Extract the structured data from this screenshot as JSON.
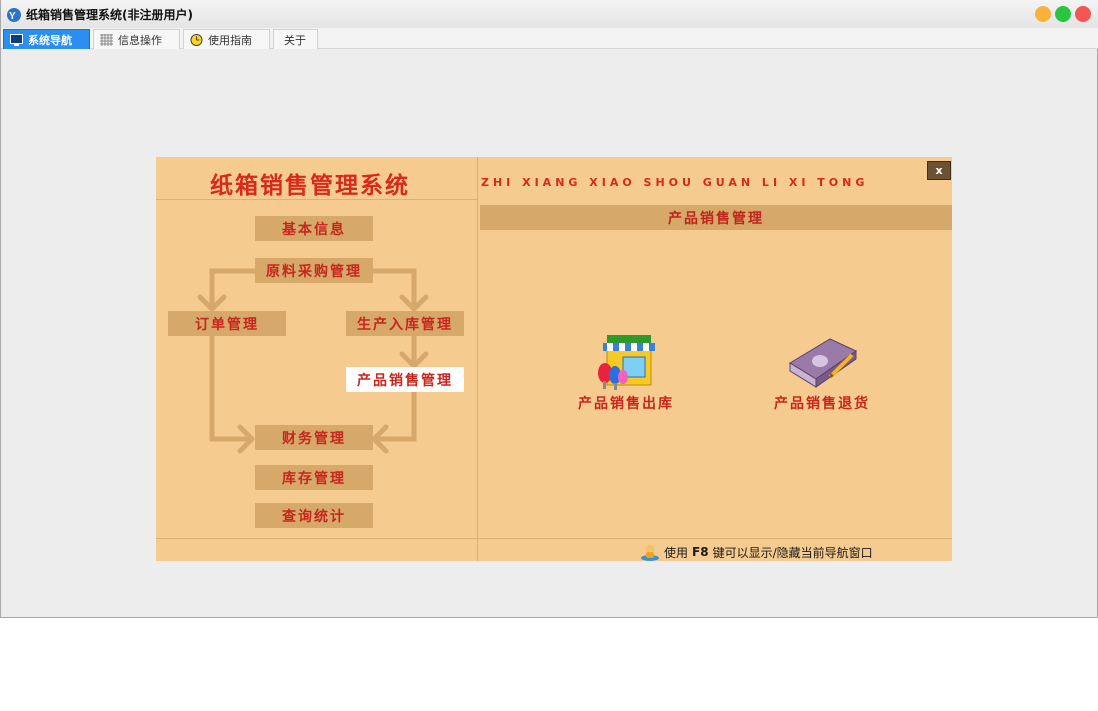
{
  "window": {
    "title": "纸箱销售管理系统(非注册用户)",
    "icon": "app-logo-icon"
  },
  "tabs": [
    {
      "label": "系统导航",
      "icon": "monitor-icon",
      "active": true
    },
    {
      "label": "信息操作",
      "icon": "grid-icon",
      "active": false
    },
    {
      "label": "使用指南",
      "icon": "clock-icon",
      "active": false
    },
    {
      "label": "关于",
      "icon": "",
      "active": false
    }
  ],
  "panel": {
    "title": "纸箱销售管理系统",
    "pinyin": "ZHI XIANG XIAO SHOU GUAN LI XI TONG",
    "close_label": "x",
    "section_title": "产品销售管理"
  },
  "flow": {
    "basic_info": "基本信息",
    "raw_purchase": "原料采购管理",
    "order_mgmt": "订单管理",
    "production_in": "生产入库管理",
    "product_sales": "产品销售管理",
    "finance_mgmt": "财务管理",
    "inventory_mgmt": "库存管理",
    "query_stats": "查询统计"
  },
  "features": [
    {
      "label": "产品销售出库",
      "icon": "store-icon"
    },
    {
      "label": "产品销售退货",
      "icon": "book-icon"
    }
  ],
  "hint": {
    "prefix": "使用",
    "key": "F8",
    "suffix": "键可以显示/隐藏当前导航窗口",
    "icon": "user-info-icon"
  },
  "colors": {
    "panel_bg": "#f6cb8f",
    "box_bg": "#d6a96b",
    "accent_red": "#c8261c",
    "tab_active": "#2a8ff0",
    "flow_line": "#d6a96b"
  }
}
